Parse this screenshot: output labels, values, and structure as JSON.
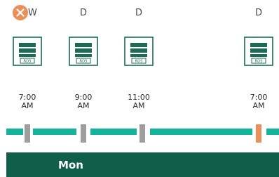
{
  "colors": {
    "track": "#12b59c",
    "marker_default": "#9e9e9e",
    "marker_selected": "#ec8e57",
    "failed_badge": "#ec8e57",
    "rds_icon": "#1c6b54",
    "day_bar": "#115f4a"
  },
  "timeline": {
    "events": [
      {
        "kind": "W",
        "status": "failed",
        "status_icon": "close-x-icon",
        "icon": "rds-database-icon",
        "icon_label": "RDS",
        "time_line1": "7:00",
        "time_line2": "AM",
        "selected": false
      },
      {
        "kind": "D",
        "status": "ok",
        "icon": "rds-database-icon",
        "icon_label": "RDS",
        "time_line1": "9:00",
        "time_line2": "AM",
        "selected": false
      },
      {
        "kind": "D",
        "status": "ok",
        "icon": "rds-database-icon",
        "icon_label": "RDS",
        "time_line1": "11:00",
        "time_line2": "AM",
        "selected": false
      },
      {
        "kind": "D",
        "status": "ok",
        "icon": "rds-database-icon",
        "icon_label": "RDS",
        "time_line1": "7:00",
        "time_line2": "AM",
        "selected": true
      }
    ],
    "day_label": "Mon"
  }
}
